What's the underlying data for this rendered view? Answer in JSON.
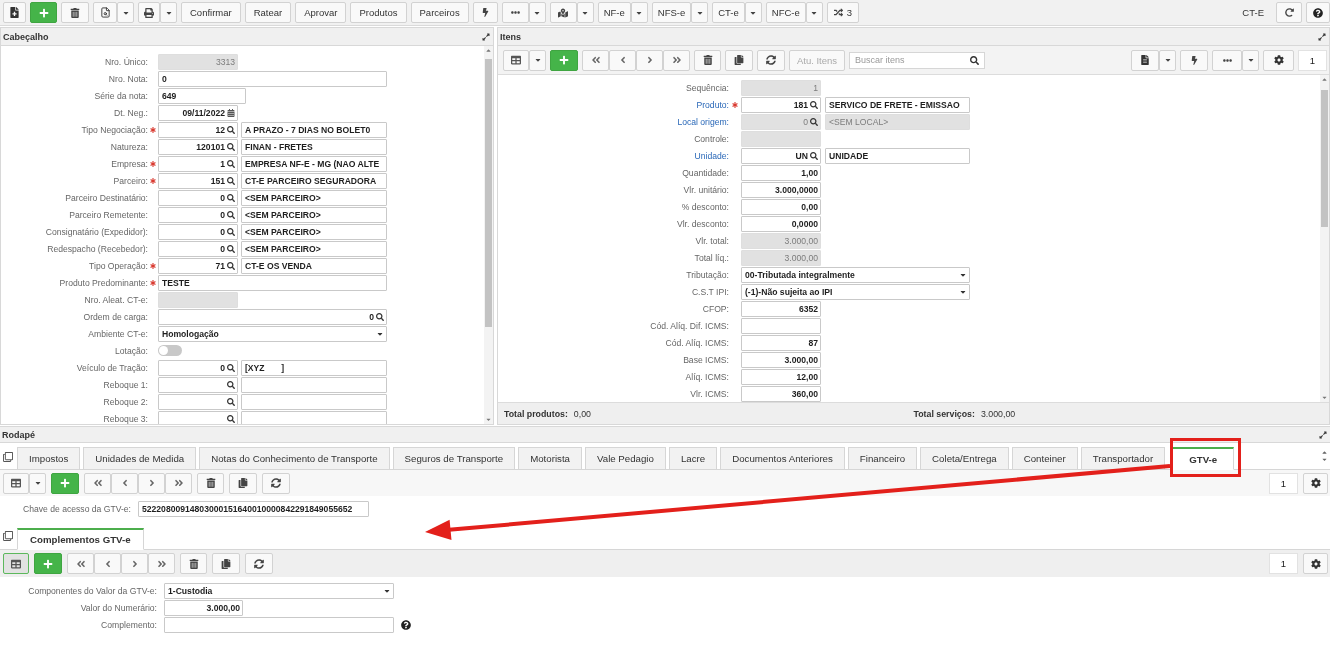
{
  "toolbar": {
    "actions": [
      "Confirmar",
      "Ratear",
      "Aprovar",
      "Produtos",
      "Parceiros"
    ],
    "documents": [
      "NF-e",
      "NFS-e",
      "CT-e",
      "NFC-e"
    ],
    "shuffle_count": "3",
    "module": "CT-E"
  },
  "header": {
    "title": "Cabeçalho",
    "fields": [
      {
        "label": "Nro. Único:",
        "kind": "number",
        "required": false,
        "disabled": true,
        "value": "3313"
      },
      {
        "label": "Nro. Nota:",
        "kind": "text",
        "required": false,
        "disabled": false,
        "value": "0"
      },
      {
        "label": "Série da nota:",
        "kind": "short_text",
        "required": false,
        "disabled": false,
        "value": "649"
      },
      {
        "label": "Dt. Neg.:",
        "kind": "date",
        "required": false,
        "disabled": false,
        "value": "09/11/2022"
      },
      {
        "label": "Tipo Negociação:",
        "kind": "lookup",
        "required": true,
        "disabled": false,
        "code": "12",
        "description": "A PRAZO - 7 DIAS NO BOLET0"
      },
      {
        "label": "Natureza:",
        "kind": "lookup",
        "required": false,
        "disabled": false,
        "code": "120101",
        "description": "FINAN - FRETES"
      },
      {
        "label": "Empresa:",
        "kind": "lookup",
        "required": true,
        "disabled": false,
        "code": "1",
        "description": "EMPRESA NF-E - MG (NAO ALTE"
      },
      {
        "label": "Parceiro:",
        "kind": "lookup",
        "required": true,
        "disabled": false,
        "code": "151",
        "description": "CT-E PARCEIRO SEGURADORA"
      },
      {
        "label": "Parceiro Destinatário:",
        "kind": "lookup",
        "required": false,
        "disabled": false,
        "code": "0",
        "description": "<SEM PARCEIRO>"
      },
      {
        "label": "Parceiro Remetente:",
        "kind": "lookup",
        "required": false,
        "disabled": false,
        "code": "0",
        "description": "<SEM PARCEIRO>"
      },
      {
        "label": "Consignatário (Expedidor):",
        "kind": "lookup",
        "required": false,
        "disabled": false,
        "code": "0",
        "description": "<SEM PARCEIRO>"
      },
      {
        "label": "Redespacho (Recebedor):",
        "kind": "lookup",
        "required": false,
        "disabled": false,
        "code": "0",
        "description": "<SEM PARCEIRO>"
      },
      {
        "label": "Tipo Operação:",
        "kind": "lookup",
        "required": true,
        "disabled": false,
        "code": "71",
        "description": "CT-E OS VENDA"
      },
      {
        "label": "Produto Predominante:",
        "kind": "text",
        "required": true,
        "disabled": false,
        "value": "TESTE"
      },
      {
        "label": "Nro. Aleat. CT-e:",
        "kind": "number",
        "required": false,
        "disabled": true
      },
      {
        "label": "Ordem de carga:",
        "kind": "wide_lookup",
        "required": false,
        "disabled": false,
        "code": "0"
      },
      {
        "label": "Ambiente CT-e:",
        "kind": "select",
        "required": false,
        "disabled": false,
        "value": "Homologação"
      },
      {
        "label": "Lotação:",
        "kind": "toggle",
        "required": false,
        "disabled": false,
        "on": false
      },
      {
        "label": "Veículo de Tração:",
        "kind": "lookup",
        "required": false,
        "disabled": false,
        "code": "0",
        "description": "[XYZ       ]"
      },
      {
        "label": "Reboque 1:",
        "kind": "lookup",
        "required": false,
        "disabled": false
      },
      {
        "label": "Reboque 2:",
        "kind": "lookup",
        "required": false,
        "disabled": false
      },
      {
        "label": "Reboque 3:",
        "kind": "lookup",
        "required": false,
        "disabled": false
      }
    ]
  },
  "items": {
    "title": "Itens",
    "toolbar": {
      "grid_pressed": false,
      "update_button": {
        "label": "Atu. Itens",
        "disabled": true
      },
      "search": {
        "placeholder": "Buscar itens"
      },
      "page": "1"
    },
    "fields": [
      {
        "label": "Sequência:",
        "kind": "number",
        "link": false,
        "required": false,
        "disabled": true,
        "value": "1"
      },
      {
        "label": "Produto:",
        "kind": "lookup",
        "link": true,
        "required": true,
        "disabled": false,
        "code": "181",
        "description": "SERVICO DE FRETE - EMISSAO"
      },
      {
        "label": "Local origem:",
        "kind": "lookup",
        "link": true,
        "required": false,
        "disabled": true,
        "code": "0",
        "description": "<SEM LOCAL>"
      },
      {
        "label": "Controle:",
        "kind": "number",
        "link": false,
        "required": false,
        "disabled": true
      },
      {
        "label": "Unidade:",
        "kind": "lookup",
        "link": true,
        "required": false,
        "disabled": false,
        "code": "UN",
        "description": "UNIDADE"
      },
      {
        "label": "Quantidade:",
        "kind": "number",
        "link": false,
        "required": false,
        "disabled": false,
        "value": "1,00"
      },
      {
        "label": "Vlr. unitário:",
        "kind": "number",
        "link": false,
        "required": false,
        "disabled": false,
        "value": "3.000,0000"
      },
      {
        "label": "% desconto:",
        "kind": "number",
        "link": false,
        "required": false,
        "disabled": false,
        "value": "0,00"
      },
      {
        "label": "Vlr. desconto:",
        "kind": "number",
        "link": false,
        "required": false,
        "disabled": false,
        "value": "0,0000"
      },
      {
        "label": "Vlr. total:",
        "kind": "number",
        "link": false,
        "required": false,
        "disabled": true,
        "value": "3.000,00"
      },
      {
        "label": "Total líq.:",
        "kind": "number",
        "link": false,
        "required": false,
        "disabled": true,
        "value": "3.000,00"
      },
      {
        "label": "Tributação:",
        "kind": "select",
        "link": false,
        "required": false,
        "disabled": false,
        "value": "00-Tributada integralmente"
      },
      {
        "label": "C.S.T IPI:",
        "kind": "select",
        "link": false,
        "required": false,
        "disabled": false,
        "value": "(-1)-Não sujeita ao IPI"
      },
      {
        "label": "CFOP:",
        "kind": "number",
        "link": false,
        "required": false,
        "disabled": false,
        "value": "6352"
      },
      {
        "label": "Cód. Alíq. Dif. ICMS:",
        "kind": "number",
        "link": false,
        "required": false,
        "disabled": false
      },
      {
        "label": "Cód. Alíq. ICMS:",
        "kind": "number",
        "link": false,
        "required": false,
        "disabled": false,
        "value": "87"
      },
      {
        "label": "Base ICMS:",
        "kind": "number",
        "link": false,
        "required": false,
        "disabled": false,
        "value": "3.000,00"
      },
      {
        "label": "Alíq. ICMS:",
        "kind": "number",
        "link": false,
        "required": false,
        "disabled": false,
        "value": "12,00"
      },
      {
        "label": "Vlr. ICMS:",
        "kind": "number",
        "link": false,
        "required": false,
        "disabled": false,
        "value": "360,00"
      }
    ],
    "totals": [
      {
        "label": "Total produtos:",
        "value": "0,00"
      },
      {
        "label": "Total serviços:",
        "value": "3.000,00"
      }
    ]
  },
  "footer": {
    "title": "Rodapé",
    "tabs": [
      {
        "label": "Impostos",
        "selected": false
      },
      {
        "label": "Unidades de Medida",
        "selected": false
      },
      {
        "label": "Notas do Conhecimento de Transporte",
        "selected": false
      },
      {
        "label": "Seguros de Transporte",
        "selected": false
      },
      {
        "label": "Motorista",
        "selected": false
      },
      {
        "label": "Vale Pedagio",
        "selected": false
      },
      {
        "label": "Lacre",
        "selected": false
      },
      {
        "label": "Documentos Anteriores",
        "selected": false
      },
      {
        "label": "Financeiro",
        "selected": false
      },
      {
        "label": "Coleta/Entrega",
        "selected": false
      },
      {
        "label": "Conteiner",
        "selected": false
      },
      {
        "label": "Transportador",
        "selected": false
      },
      {
        "label": "GTV-e",
        "selected": true
      }
    ],
    "toolbar": {
      "grid_pressed": false,
      "page": "1"
    },
    "fields": [
      {
        "label": "Chave de acesso da GTV-e:",
        "kind": "text",
        "help": false,
        "value": "52220800914803000151640010000842291849055652"
      }
    ],
    "complements": {
      "tabs": [
        {
          "label": "Complementos GTV-e",
          "selected": true
        }
      ],
      "toolbar": {
        "grid_pressed": true,
        "page": "1"
      },
      "fields": [
        {
          "label": "Componentes do Valor da GTV-e:",
          "kind": "select",
          "help": false,
          "value": "1-Custodia"
        },
        {
          "label": "Valor do Numerário:",
          "kind": "number",
          "help": false,
          "value": "3.000,00"
        },
        {
          "label": "Complemento:",
          "kind": "text",
          "help": true
        }
      ]
    }
  }
}
